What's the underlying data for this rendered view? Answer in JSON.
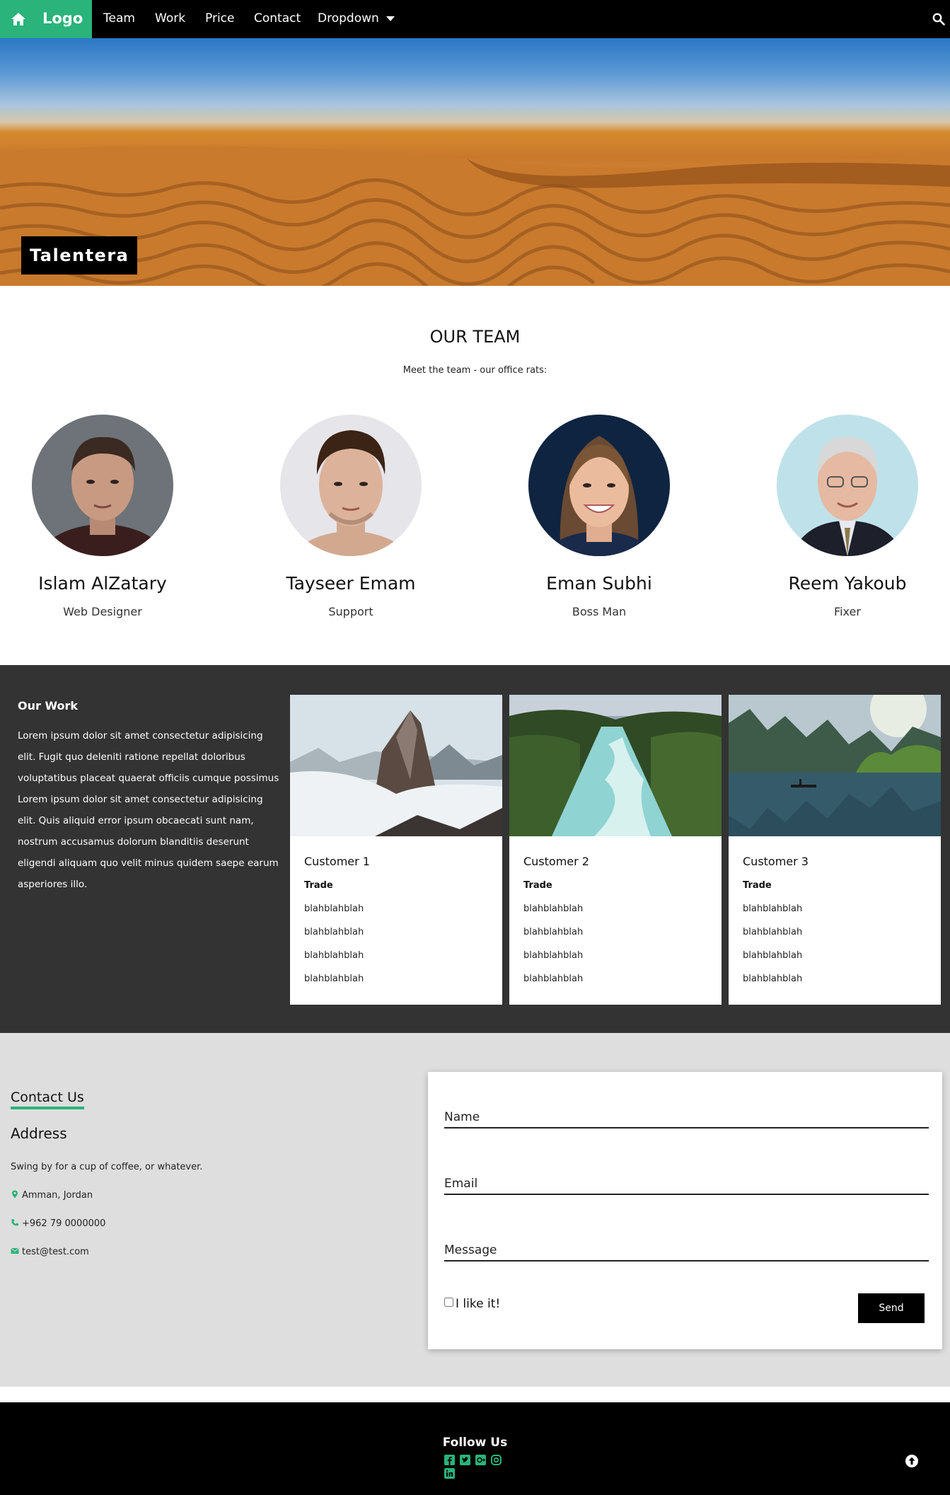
{
  "nav": {
    "logo": "Logo",
    "items": [
      "Team",
      "Work",
      "Price",
      "Contact",
      "Dropdown"
    ],
    "accent": "#2ab37a"
  },
  "hero": {
    "badge": "Talentera"
  },
  "team": {
    "title": "OUR TEAM",
    "subtitle": "Meet the team - our office rats:",
    "members": [
      {
        "name": "Islam AlZatary",
        "role": "Web Designer"
      },
      {
        "name": "Tayseer Emam",
        "role": "Support"
      },
      {
        "name": "Eman Subhi",
        "role": "Boss Man"
      },
      {
        "name": "Reem Yakoub",
        "role": "Fixer"
      }
    ]
  },
  "work": {
    "heading": "Our Work",
    "text": "Lorem ipsum dolor sit amet consectetur adipisicing elit. Fugit quo deleniti ratione repellat doloribus voluptatibus placeat quaerat officiis cumque possimus Lorem ipsum dolor sit amet consectetur adipisicing elit. Quis aliquid error ipsum obcaecati sunt nam, nostrum accusamus dolorum blanditiis deserunt eligendi aliquam quo velit minus quidem saepe earum asperiores illo.",
    "cards": [
      {
        "customer": "Customer 1",
        "trade": "Trade",
        "lines": [
          "blahblahblah",
          "blahblahblah",
          "blahblahblah",
          "blahblahblah"
        ]
      },
      {
        "customer": "Customer 2",
        "trade": "Trade",
        "lines": [
          "blahblahblah",
          "blahblahblah",
          "blahblahblah",
          "blahblahblah"
        ]
      },
      {
        "customer": "Customer 3",
        "trade": "Trade",
        "lines": [
          "blahblahblah",
          "blahblahblah",
          "blahblahblah",
          "blahblahblah"
        ]
      }
    ]
  },
  "contact": {
    "title": "Contact Us",
    "address_heading": "Address",
    "description": "Swing by for a cup of coffee, or whatever.",
    "location": "Amman, Jordan",
    "phone": "+962 79 0000000",
    "email": "test@test.com",
    "form": {
      "name_placeholder": "Name",
      "email_placeholder": "Email",
      "message_placeholder": "Message",
      "checkbox_label": "I like it!",
      "send_label": "Send"
    }
  },
  "footer": {
    "title": "Follow Us",
    "social_icons": [
      "facebook-icon",
      "twitter-icon",
      "google-plus-icon",
      "instagram-icon",
      "linkedin-icon"
    ]
  }
}
